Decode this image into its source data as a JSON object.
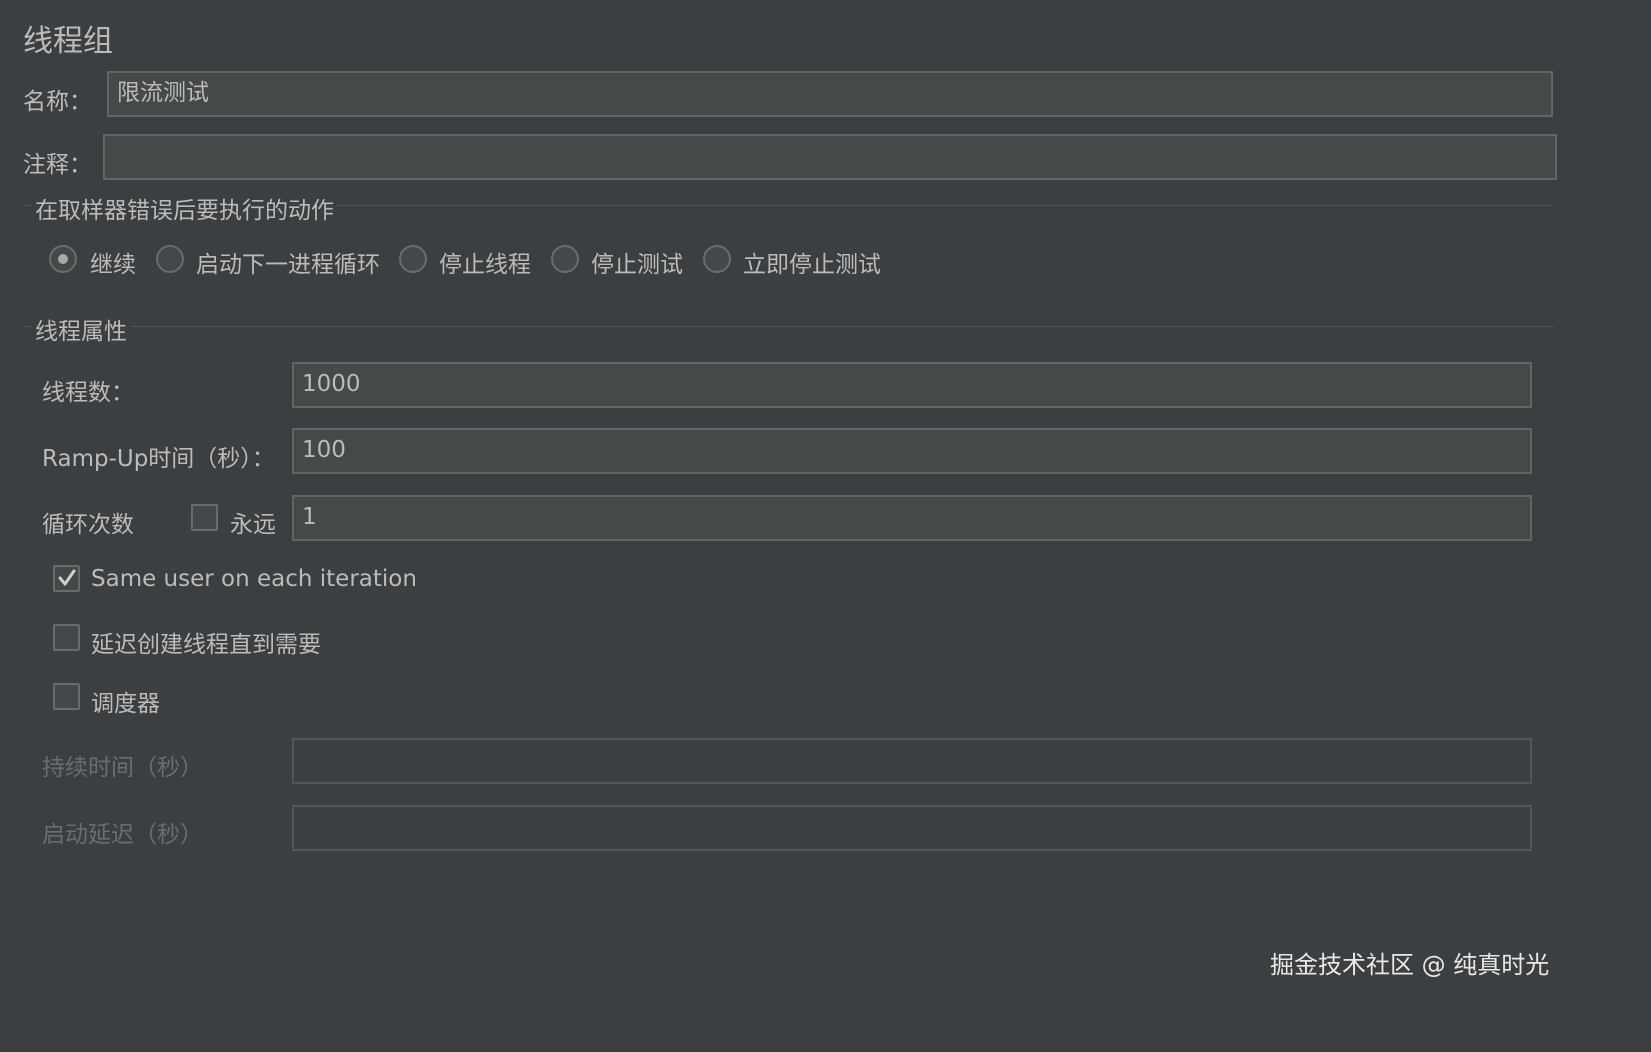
{
  "panel_title": "线程组",
  "name_label": "名称：",
  "name_value": "限流测试",
  "comment_label": "注释：",
  "comment_value": "",
  "on_error": {
    "section_title": "在取样器错误后要执行的动作",
    "options": [
      {
        "label": "继续",
        "selected": true
      },
      {
        "label": "启动下一进程循环",
        "selected": false
      },
      {
        "label": "停止线程",
        "selected": false
      },
      {
        "label": "停止测试",
        "selected": false
      },
      {
        "label": "立即停止测试",
        "selected": false
      }
    ]
  },
  "thread_props": {
    "section_title": "线程属性",
    "threads_label": "线程数：",
    "threads_value": "1000",
    "rampup_label": "Ramp-Up时间（秒）：",
    "rampup_value": "100",
    "loop_label": "循环次数",
    "forever_label": "永远",
    "forever_checked": false,
    "loop_value": "1",
    "same_user_label": "Same user on each iteration",
    "same_user_checked": true,
    "delay_label": "延迟创建线程直到需要",
    "delay_checked": false,
    "scheduler_label": "调度器",
    "scheduler_checked": false,
    "duration_label": "持续时间（秒）",
    "duration_value": "",
    "startup_delay_label": "启动延迟（秒）",
    "startup_delay_value": ""
  },
  "watermark": "掘金技术社区 @ 纯真时光",
  "colors": {
    "background": "#3c3f41",
    "field_bg": "#45494a",
    "text": "#bbbbbb",
    "disabled_text": "#6a6d70"
  }
}
